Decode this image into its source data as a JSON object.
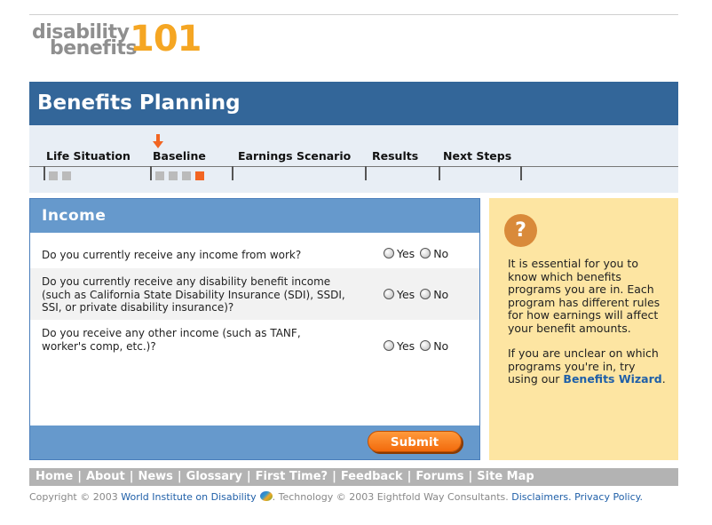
{
  "logo": {
    "line1": "disability",
    "line2": "benefits",
    "number": "101"
  },
  "title": "Benefits Planning",
  "steps": [
    {
      "label": "Life Situation"
    },
    {
      "label": "Baseline"
    },
    {
      "label": "Earnings Scenario"
    },
    {
      "label": "Results"
    },
    {
      "label": "Next Steps"
    }
  ],
  "current_step": "Baseline",
  "baseline_progress": {
    "completed": 3,
    "total": 4
  },
  "form": {
    "heading": "Income",
    "questions": [
      {
        "text": "Do you currently receive any income from work?",
        "yes": "Yes",
        "no": "No"
      },
      {
        "text": "Do you currently receive any disability benefit income (such as California State Disability Insurance (SDI), SSDI, SSI, or private disability insurance)?",
        "yes": "Yes",
        "no": "No"
      },
      {
        "text": "Do you receive any other income (such as TANF, worker's comp, etc.)?",
        "yes": "Yes",
        "no": "No"
      }
    ],
    "submit_label": "Submit"
  },
  "help": {
    "icon": "question-icon",
    "icon_glyph": "?",
    "para1": "It is essential for you to know which  benefits programs you are in. Each program has different rules for how earnings will affect your benefit amounts.",
    "para2_prefix": "If you are unclear on which programs you're in, try using our ",
    "link": "Benefits Wizard",
    "para2_suffix": "."
  },
  "nav": [
    "Home",
    "About",
    "News",
    "Glossary",
    "First Time?",
    "Feedback",
    "Forums",
    "Site Map"
  ],
  "footer": {
    "copy1": "Copyright © 2003 ",
    "wid_link": "World Institute on Disability",
    "copy2": ".  Technology © 2003 Eightfold Way Consultants.  ",
    "disclaimers": "Disclaimers.",
    "privacy": "Privacy Policy."
  },
  "colors": {
    "brand_blue": "#336699",
    "accent_orange": "#f26522",
    "help_bg": "#fde5a2"
  }
}
